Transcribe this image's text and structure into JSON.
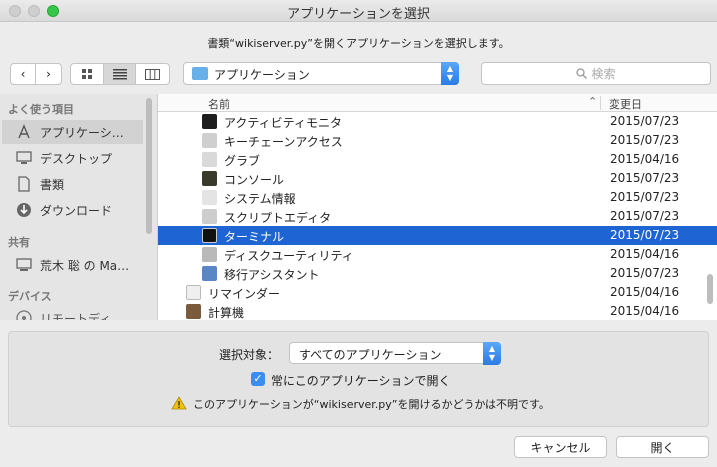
{
  "window": {
    "title": "アプリケーションを選択"
  },
  "prompt": "書類“wikiserver.py”を開くアプリケーションを選択します。",
  "toolbar": {
    "location": "アプリケーション",
    "search_placeholder": "検索"
  },
  "sidebar": {
    "sections": [
      {
        "title": "よく使う項目"
      },
      {
        "title": "共有"
      },
      {
        "title": "デバイス"
      }
    ],
    "items": [
      {
        "label": "アプリケーシ…",
        "icon": "applications-icon"
      },
      {
        "label": "デスクトップ",
        "icon": "desktop-icon"
      },
      {
        "label": "書類",
        "icon": "documents-icon"
      },
      {
        "label": "ダウンロード",
        "icon": "downloads-icon"
      },
      {
        "label": "荒木 聡 の Ma…",
        "icon": "computer-icon"
      },
      {
        "label": "リモートディ…",
        "icon": "remote-disc-icon"
      }
    ]
  },
  "list": {
    "columns": {
      "name": "名前",
      "date": "変更日"
    },
    "rows": [
      {
        "name": "アクティビティモニタ",
        "date": "2015/07/23"
      },
      {
        "name": "キーチェーンアクセス",
        "date": "2015/07/23"
      },
      {
        "name": "グラブ",
        "date": "2015/04/16"
      },
      {
        "name": "コンソール",
        "date": "2015/07/23"
      },
      {
        "name": "システム情報",
        "date": "2015/07/23"
      },
      {
        "name": "スクリプトエディタ",
        "date": "2015/07/23"
      },
      {
        "name": "ターミナル",
        "date": "2015/07/23"
      },
      {
        "name": "ディスクユーティリティ",
        "date": "2015/04/16"
      },
      {
        "name": "移行アシスタント",
        "date": "2015/07/23"
      },
      {
        "name": "リマインダー",
        "date": "2015/04/16"
      },
      {
        "name": "計算機",
        "date": "2015/04/16"
      }
    ]
  },
  "options": {
    "enable_label": "選択対象：",
    "enable_value": "すべてのアプリケーション",
    "always_open_label": "常にこのアプリケーションで開く",
    "always_open_checked": true,
    "warning": "このアプリケーションが“wikiserver.py”を開けるかどうかは不明です。"
  },
  "buttons": {
    "cancel": "キャンセル",
    "open": "開く"
  },
  "colors": {
    "selection": "#1e64d3",
    "accent": "#3b8df0"
  }
}
